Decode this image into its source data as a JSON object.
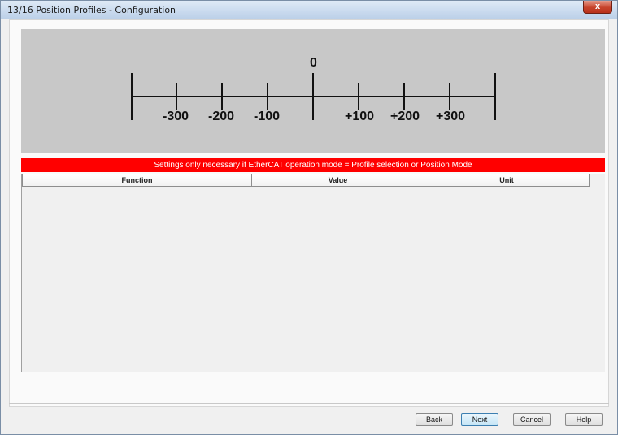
{
  "window": {
    "title": "13/16 Position Profiles - Configuration",
    "close_label": "x"
  },
  "diagram": {
    "ticks": [
      {
        "label": "-300",
        "value": -300
      },
      {
        "label": "-200",
        "value": -200
      },
      {
        "label": "-100",
        "value": -100
      },
      {
        "label": "0",
        "value": 0
      },
      {
        "label": "+100",
        "value": 100
      },
      {
        "label": "+200",
        "value": 200
      },
      {
        "label": "+300",
        "value": 300
      }
    ],
    "panel_color": "#c8c8c8"
  },
  "warning": {
    "text": "Settings only necessary if EtherCAT operation mode = Profile selection or Position Mode",
    "color": "#ff0000"
  },
  "table": {
    "columns": [
      "Function",
      "Value",
      "Unit"
    ],
    "rows": []
  },
  "buttons": {
    "back": "Back",
    "next": "Next",
    "cancel": "Cancel",
    "help": "Help"
  }
}
